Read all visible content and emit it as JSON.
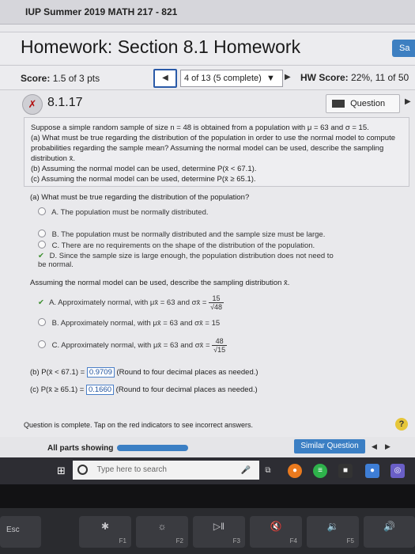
{
  "course": {
    "title": "IUP Summer 2019 MATH 217 - 821"
  },
  "header": {
    "title": "Homework: Section 8.1 Homework",
    "save_label": "Sa"
  },
  "score_bar": {
    "score_label": "Score:",
    "score_value": "1.5 of 3 pts",
    "progress": "4 of 13 (5 complete)",
    "hw_score_label": "HW Score:",
    "hw_score_value": "22%, 11 of 50"
  },
  "question": {
    "number": "8.1.17",
    "help_label": "Question Help"
  },
  "problem": {
    "line1": "Suppose a simple random sample of size n = 48 is obtained from a population with μ = 63 and σ = 15.",
    "line2": "(a) What must be true regarding the distribution of the population in order to use the normal model to compute probabilities regarding the sample mean? Assuming the normal model can be used, describe the sampling distribution x̄.",
    "line3": "(b) Assuming the normal model can be used, determine P(x̄ < 67.1).",
    "line4": "(c) Assuming the normal model can be used, determine P(x̄ ≥ 65.1)."
  },
  "part_a": {
    "question": "(a) What must be true regarding the distribution of the population?",
    "options": [
      {
        "letter": "A.",
        "text": "The population must be normally distributed."
      },
      {
        "letter": "B.",
        "text": "The population must be normally distributed and the sample size must be large."
      },
      {
        "letter": "C.",
        "text": "There are no requirements on the shape of the distribution of the population."
      },
      {
        "letter": "D.",
        "text": "Since the sample size is large enough, the population distribution does not need to be normal."
      }
    ]
  },
  "sampling": {
    "question": "Assuming the normal model can be used, describe the sampling distribution x̄.",
    "options": [
      {
        "letter": "A.",
        "text": "Approximately normal, with μx̄ = 63 and σx̄ =",
        "num": "15",
        "den": "√48"
      },
      {
        "letter": "B.",
        "text": "Approximately normal, with μx̄ = 63 and σx̄ = 15"
      },
      {
        "letter": "C.",
        "text": "Approximately normal, with μx̄ = 63 and σx̄ =",
        "num": "48",
        "den": "√15"
      }
    ]
  },
  "part_b": {
    "prefix": "(b) P(x̄ < 67.1) =",
    "answer": "0.9709",
    "note": "(Round to four decimal places as needed.)"
  },
  "part_c": {
    "prefix": "(c) P(x̄ ≥ 65.1) =",
    "answer": "0.1660",
    "note": "(Round to four decimal places as needed.)"
  },
  "footer": {
    "complete_text": "Question is complete. Tap on the red indicators to see incorrect answers.",
    "parts_label": "All parts showing",
    "similar_label": "Similar Question"
  },
  "taskbar": {
    "search_placeholder": "Type here to search"
  },
  "keys": {
    "esc": "Esc",
    "f1": "F1",
    "f2": "F2",
    "f3": "F3",
    "f4": "F4",
    "f5": "F5"
  },
  "colors": {
    "accent_blue": "#3b7fc4",
    "correct_green": "#3c8f2e",
    "wrong_red": "#b31010"
  }
}
